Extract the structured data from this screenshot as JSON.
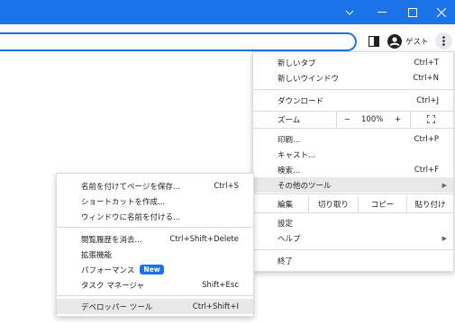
{
  "window": {
    "controls": [
      "chevron-down-icon",
      "minimize-icon",
      "maximize-icon",
      "close-icon"
    ]
  },
  "toolbar": {
    "profile_label": "ゲスト"
  },
  "main_menu": {
    "items": [
      {
        "label": "新しいタブ",
        "shortcut": "Ctrl+T"
      },
      {
        "label": "新しいウインドウ",
        "shortcut": "Ctrl+N"
      },
      {
        "label": "ダウンロード",
        "shortcut": "Ctrl+J"
      },
      {
        "label": "ズーム",
        "zoom_minus": "−",
        "zoom_value": "100%",
        "zoom_plus": "+"
      },
      {
        "label": "印刷...",
        "shortcut": "Ctrl+P"
      },
      {
        "label": "キャスト..."
      },
      {
        "label": "検索...",
        "shortcut": "Ctrl+F"
      },
      {
        "label": "その他のツール"
      },
      {
        "label": "編集",
        "cut": "切り取り",
        "copy": "コピー",
        "paste": "貼り付け"
      },
      {
        "label": "設定"
      },
      {
        "label": "ヘルプ"
      },
      {
        "label": "終了"
      }
    ]
  },
  "sub_menu": {
    "items": [
      {
        "label": "名前を付けてページを保存...",
        "shortcut": "Ctrl+S"
      },
      {
        "label": "ショートカットを作成..."
      },
      {
        "label": "ウィンドウに名前を付ける..."
      },
      {
        "label": "閲覧履歴を消去...",
        "shortcut": "Ctrl+Shift+Delete"
      },
      {
        "label": "拡張機能"
      },
      {
        "label": "パフォーマンス",
        "badge": "New"
      },
      {
        "label": "タスク マネージャ",
        "shortcut": "Shift+Esc"
      },
      {
        "label": "デベロッパー ツール",
        "shortcut": "Ctrl+Shift+I"
      }
    ]
  }
}
